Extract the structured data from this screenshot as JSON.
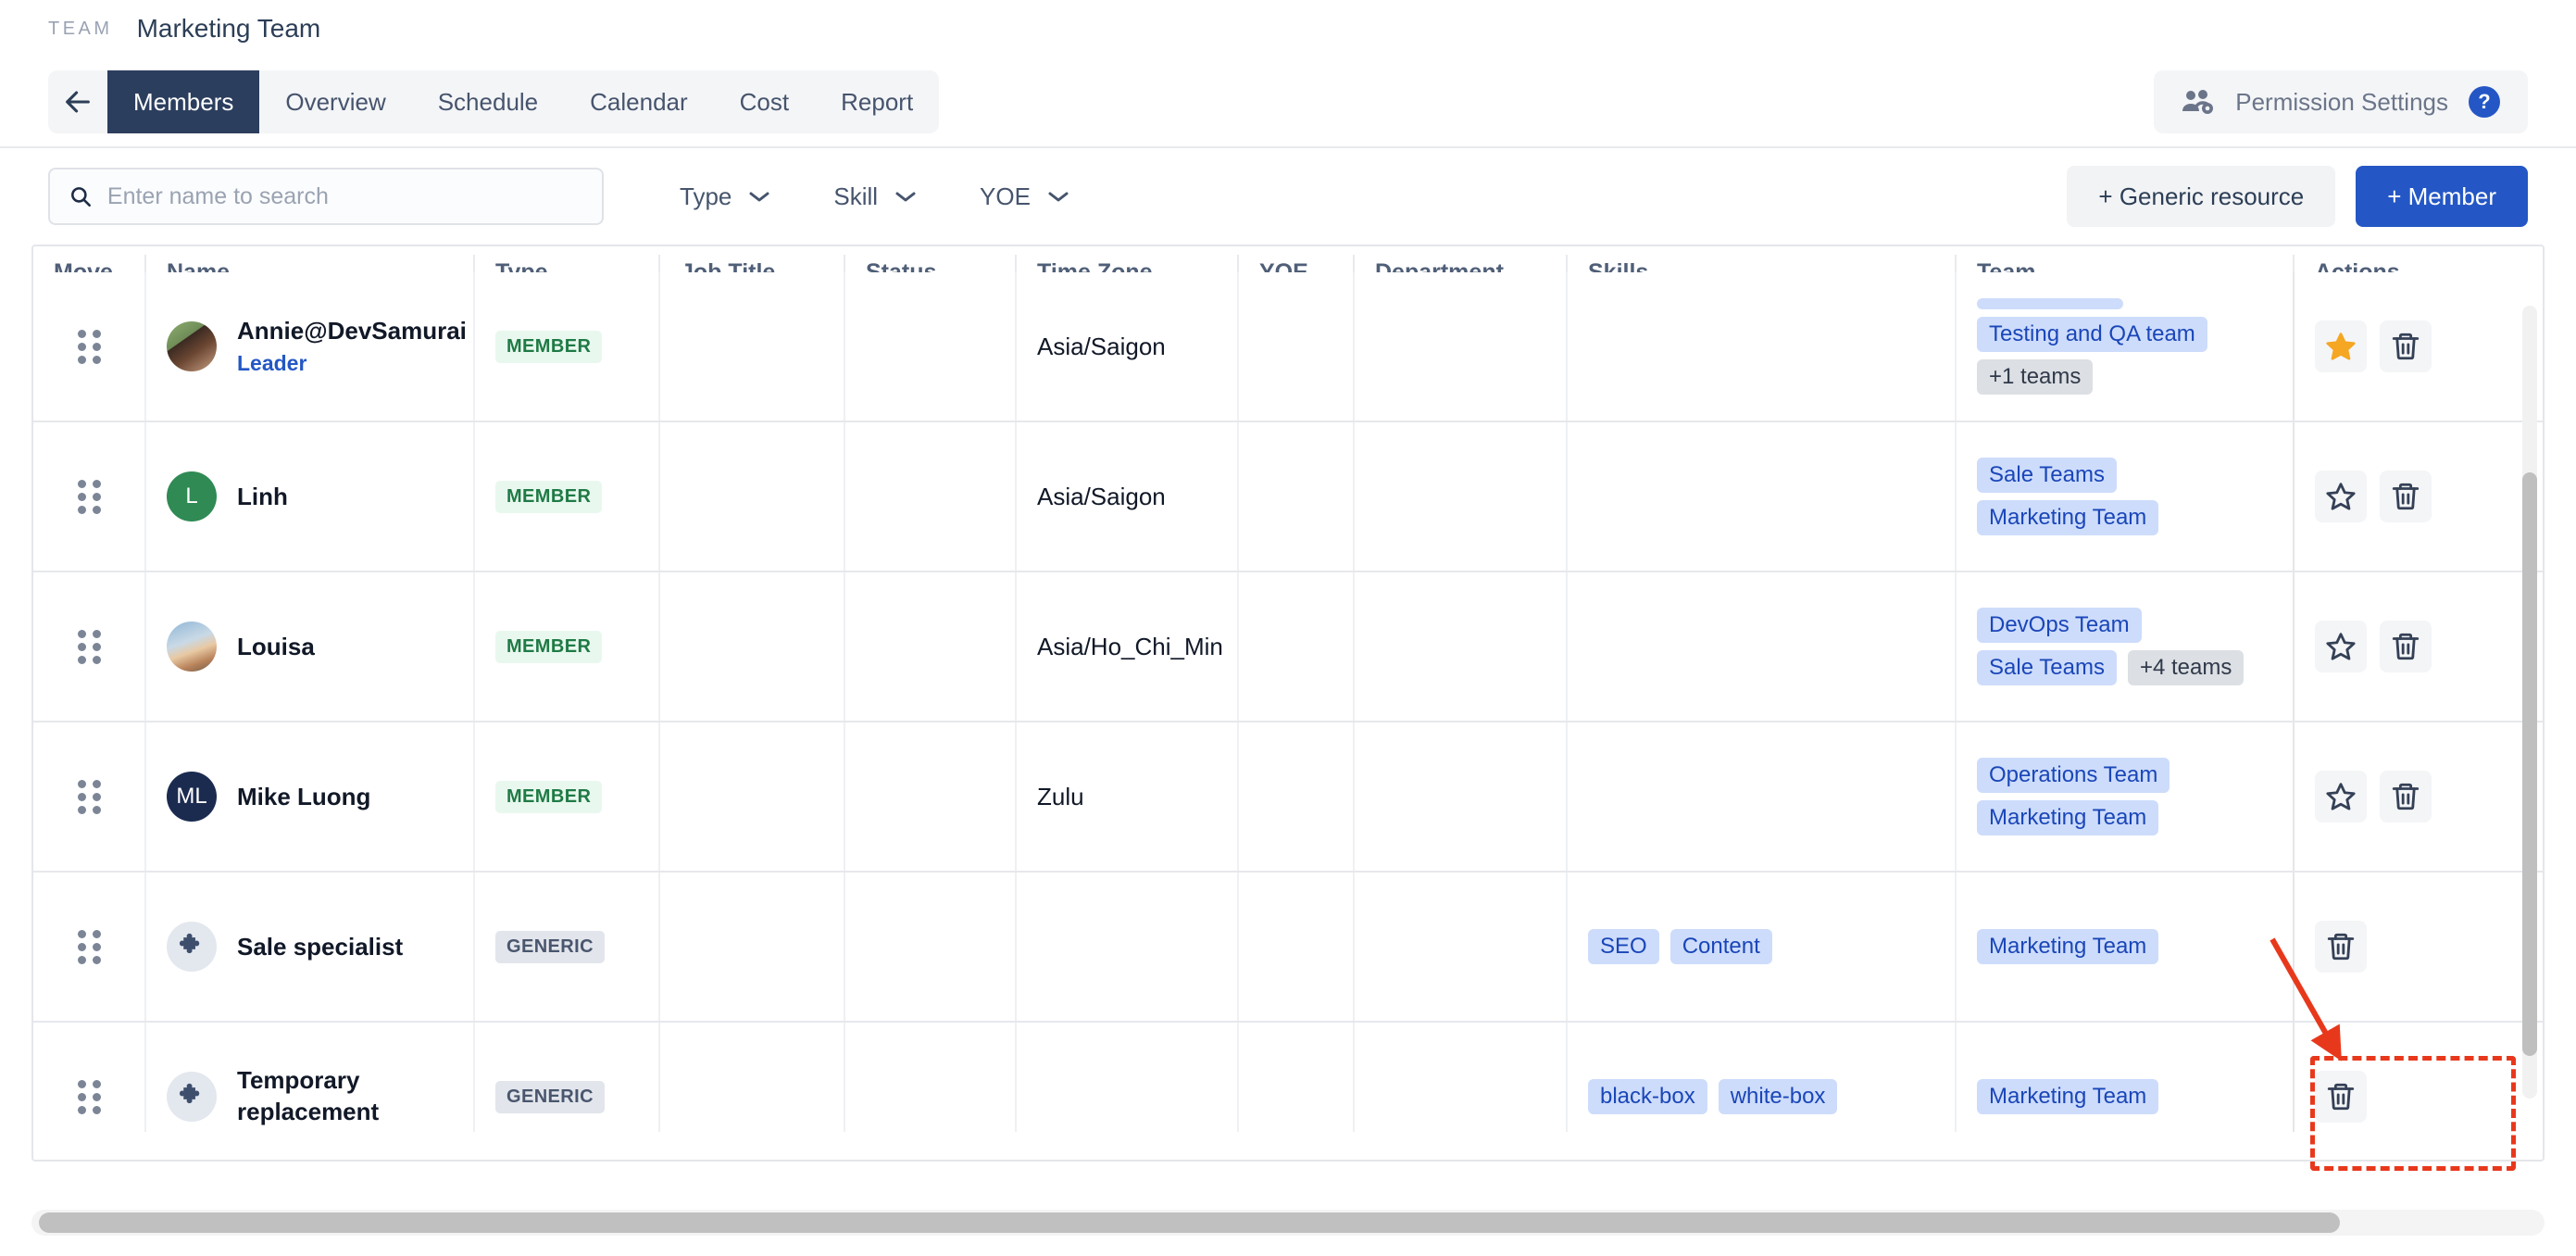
{
  "breadcrumb": {
    "label": "TEAM",
    "title": "Marketing Team"
  },
  "nav": {
    "back_icon": "arrow-left-icon",
    "tabs": [
      {
        "label": "Members",
        "active": true
      },
      {
        "label": "Overview",
        "active": false
      },
      {
        "label": "Schedule",
        "active": false
      },
      {
        "label": "Calendar",
        "active": false
      },
      {
        "label": "Cost",
        "active": false
      },
      {
        "label": "Report",
        "active": false
      }
    ],
    "permission_settings": "Permission Settings",
    "help_badge": "?"
  },
  "toolbar": {
    "search_placeholder": "Enter name to search",
    "search_value": "",
    "search_icon": "search-icon",
    "filters": [
      {
        "label": "Type"
      },
      {
        "label": "Skill"
      },
      {
        "label": "YOE"
      }
    ],
    "generic_resource_button": "+ Generic resource",
    "member_button": "+ Member"
  },
  "table": {
    "columns": [
      "Move",
      "Name",
      "Type",
      "Job Title",
      "Status",
      "Time Zone",
      "YOE",
      "Department",
      "Skills",
      "Team",
      "Actions"
    ],
    "rows": [
      {
        "name": "Annie@DevSamurai",
        "subtitle": "Leader",
        "avatar_kind": "photo",
        "avatar_initials": "",
        "type": "MEMBER",
        "job_title": "",
        "status": "",
        "time_zone": "Asia/Saigon",
        "yoe": "",
        "department": "",
        "skills": [],
        "teams": [
          "Testing and QA team"
        ],
        "teams_more": "+1 teams",
        "starred": true,
        "has_star": true,
        "clipped_tag_above": true
      },
      {
        "name": "Linh",
        "subtitle": "",
        "avatar_kind": "initial-green",
        "avatar_initials": "L",
        "type": "MEMBER",
        "job_title": "",
        "status": "",
        "time_zone": "Asia/Saigon",
        "yoe": "",
        "department": "",
        "skills": [],
        "teams": [
          "Sale Teams",
          "Marketing Team"
        ],
        "teams_more": "",
        "starred": false,
        "has_star": true,
        "clipped_tag_above": false
      },
      {
        "name": "Louisa",
        "subtitle": "",
        "avatar_kind": "photo2",
        "avatar_initials": "",
        "type": "MEMBER",
        "job_title": "",
        "status": "",
        "time_zone": "Asia/Ho_Chi_Min",
        "yoe": "",
        "department": "",
        "skills": [],
        "teams": [
          "DevOps Team",
          "Sale Teams"
        ],
        "teams_more": "+4 teams",
        "starred": false,
        "has_star": true,
        "clipped_tag_above": false
      },
      {
        "name": "Mike Luong",
        "subtitle": "",
        "avatar_kind": "initial-navy",
        "avatar_initials": "ML",
        "type": "MEMBER",
        "job_title": "",
        "status": "",
        "time_zone": "Zulu",
        "yoe": "",
        "department": "",
        "skills": [],
        "teams": [
          "Operations Team",
          "Marketing Team"
        ],
        "teams_more": "",
        "starred": false,
        "has_star": true,
        "clipped_tag_above": false
      },
      {
        "name": "Sale specialist",
        "subtitle": "",
        "avatar_kind": "puzzle",
        "avatar_initials": "",
        "type": "GENERIC",
        "job_title": "",
        "status": "",
        "time_zone": "",
        "yoe": "",
        "department": "",
        "skills": [
          "SEO",
          "Content"
        ],
        "teams": [
          "Marketing Team"
        ],
        "teams_more": "",
        "starred": false,
        "has_star": false,
        "clipped_tag_above": false
      },
      {
        "name": "Temporary replacement",
        "subtitle": "",
        "avatar_kind": "puzzle",
        "avatar_initials": "",
        "type": "GENERIC",
        "job_title": "",
        "status": "",
        "time_zone": "",
        "yoe": "",
        "department": "",
        "skills": [
          "black-box",
          "white-box"
        ],
        "teams": [
          "Marketing Team"
        ],
        "teams_more": "",
        "starred": false,
        "has_star": false,
        "clipped_tag_above": false
      }
    ]
  },
  "icons": {
    "drag_handle": "drag-handle-icon",
    "star": "star-icon",
    "trash": "trash-icon",
    "chevron_down": "chevron-down-icon",
    "people_gear": "people-gear-icon"
  },
  "annotation": {
    "highlight_color": "#e8381c",
    "target": "delete-button-last-row"
  },
  "colors": {
    "accent": "#2457c5",
    "tab_active_bg": "#2c3e5e",
    "tag_bg": "#cddcfb",
    "tag_text": "#1a46b8",
    "member_badge_bg": "#e9f8ef",
    "member_badge_text": "#1f7a45",
    "generic_badge_bg": "#e2e5eb",
    "star_active": "#f5a623"
  }
}
